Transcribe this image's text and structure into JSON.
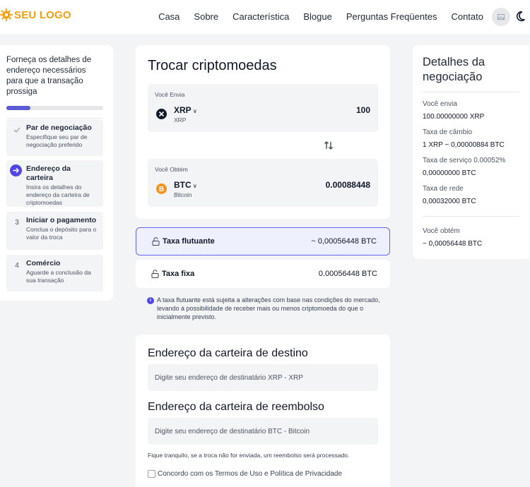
{
  "header": {
    "logo_text": "SEU LOGO",
    "nav": [
      "Casa",
      "Sobre",
      "Característica",
      "Blogue",
      "Perguntas Freqüentes",
      "Contato"
    ]
  },
  "steps": {
    "intro": "Forneça os detalhes de endereço necessários para que a transação prossiga",
    "progress_percent": 25,
    "items": [
      {
        "number": "",
        "title": "Par de negociação",
        "desc": "Especifique seu par de negociação preferido",
        "state": "done"
      },
      {
        "number": "",
        "title": "Endereço da carteira",
        "desc": "Insira os detalhes do endereço da carteira de criptomoedas",
        "state": "active"
      },
      {
        "number": "3",
        "title": "Iniciar o pagamento",
        "desc": "Conclua o depósito para o valor da troca",
        "state": "pending"
      },
      {
        "number": "4",
        "title": "Comércio",
        "desc": "Aguarde a conclusão da sua transação",
        "state": "pending"
      }
    ]
  },
  "swap": {
    "title": "Trocar criptomoedas",
    "send": {
      "label": "Você Envia",
      "symbol": "XRP",
      "name": "XRP",
      "amount": "100"
    },
    "get": {
      "label": "Você Obtém",
      "symbol": "BTC",
      "name": "Bitcoin",
      "amount": "0.00088448"
    },
    "swap_icon": "swap-vertical-icon"
  },
  "rates": {
    "float": {
      "label": "Taxa flutuante",
      "value": "~ 0,00056448 BTC",
      "selected": true
    },
    "fixed": {
      "label": "Taxa fixa",
      "value": "0.00056448 BTC",
      "selected": false
    }
  },
  "note": "A taxa flutuante está sujeita a alterações com base nas condições do mercado, levando à possibilidade de receber mais ou menos criptomoeda do que o inicialmente previsto.",
  "address": {
    "dest_title": "Endereço da carteira de destino",
    "dest_placeholder": "Digite seu endereço de destinatário XRP - XRP",
    "refund_title": "Endereço da carteira de reembolso",
    "refund_placeholder": "Digite seu endereço de destinatário BTC - Bitcoin",
    "refund_note": "Fique tranquilo, se a troca não for enviada, um reembolso será processado.",
    "terms": "Concordo com os Termos de Uso e Política de Privacidade"
  },
  "details": {
    "title": "Detalhes da negociação",
    "rows": [
      {
        "label": "Você envia",
        "value": "100.00000000 XRP"
      },
      {
        "label": "Taxa de câmbio",
        "value": "1 XRP ~ 0,00000884 BTC"
      },
      {
        "label": "Taxa de serviço 0.00052%",
        "value": "0,00000000 BTC"
      },
      {
        "label": "Taxa de rede",
        "value": "0,00032000 BTC"
      }
    ],
    "receive_label": "Você obtém",
    "receive_value": "~ 0,00056448 BTC"
  },
  "colors": {
    "accent": "#4f46e5",
    "logo": "#f59e0b",
    "btc": "#f7931a"
  }
}
